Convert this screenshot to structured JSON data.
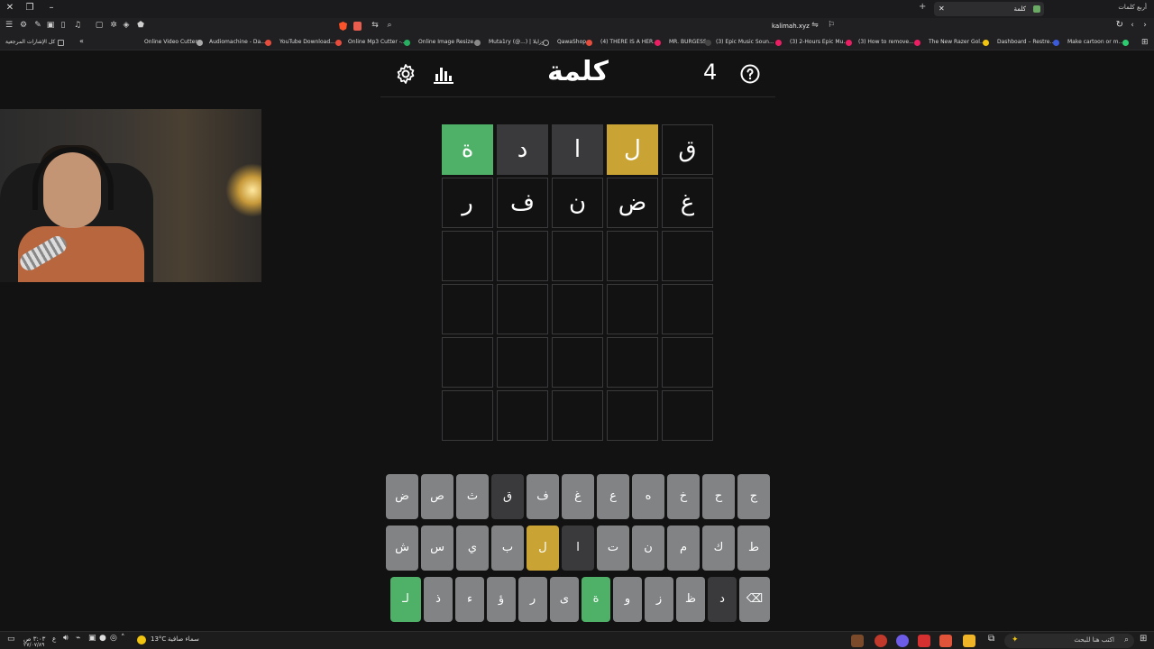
{
  "browser": {
    "tab_title": "كلمة",
    "second_tab": "أربع كلمات",
    "url": "kalimah.xyz",
    "bookmarks": [
      "Online Video Cutter",
      "Audiomachine - Da...",
      "YouTube Download...",
      "Online Mp3 Cutter -...",
      "Online Image Resize...",
      "Muta1ry (@...) | موزايلا",
      "QawaShop",
      "(4) THERE IS A HER...",
      "MR. BURGESS",
      "(3) Epic Music Soun...",
      "(3) 2-Hours Epic Mu...",
      "(3) How to remove...",
      "The New Razer Gol...",
      "Dashboard – Restre...",
      "Make cartoon or m..."
    ],
    "bookmarks_folder": "كل الإشارات المرجعية"
  },
  "game": {
    "title": "كلمة",
    "streak": "4",
    "icons": {
      "settings": "gear-icon",
      "stats": "stats-icon",
      "help": "help-icon"
    },
    "colors": {
      "green": "#4fb168",
      "yellow": "#c9a333",
      "gray": "#3a3a3c",
      "key": "#818384"
    },
    "board": [
      [
        {
          "letter": "ق",
          "state": "empty"
        },
        {
          "letter": "ل",
          "state": "yellow"
        },
        {
          "letter": "ا",
          "state": "gray"
        },
        {
          "letter": "د",
          "state": "gray"
        },
        {
          "letter": "ة",
          "state": "green"
        }
      ],
      [
        {
          "letter": "غ",
          "state": "empty"
        },
        {
          "letter": "ض",
          "state": "empty"
        },
        {
          "letter": "ن",
          "state": "empty"
        },
        {
          "letter": "ف",
          "state": "empty"
        },
        {
          "letter": "ر",
          "state": "empty"
        }
      ],
      [
        {
          "letter": "",
          "state": "empty"
        },
        {
          "letter": "",
          "state": "empty"
        },
        {
          "letter": "",
          "state": "empty"
        },
        {
          "letter": "",
          "state": "empty"
        },
        {
          "letter": "",
          "state": "empty"
        }
      ],
      [
        {
          "letter": "",
          "state": "empty"
        },
        {
          "letter": "",
          "state": "empty"
        },
        {
          "letter": "",
          "state": "empty"
        },
        {
          "letter": "",
          "state": "empty"
        },
        {
          "letter": "",
          "state": "empty"
        }
      ],
      [
        {
          "letter": "",
          "state": "empty"
        },
        {
          "letter": "",
          "state": "empty"
        },
        {
          "letter": "",
          "state": "empty"
        },
        {
          "letter": "",
          "state": "empty"
        },
        {
          "letter": "",
          "state": "empty"
        }
      ],
      [
        {
          "letter": "",
          "state": "empty"
        },
        {
          "letter": "",
          "state": "empty"
        },
        {
          "letter": "",
          "state": "empty"
        },
        {
          "letter": "",
          "state": "empty"
        },
        {
          "letter": "",
          "state": "empty"
        }
      ]
    ],
    "keyboard": [
      [
        {
          "k": "ج",
          "state": "default"
        },
        {
          "k": "ح",
          "state": "default"
        },
        {
          "k": "خ",
          "state": "default"
        },
        {
          "k": "ه",
          "state": "default"
        },
        {
          "k": "ع",
          "state": "default"
        },
        {
          "k": "غ",
          "state": "default"
        },
        {
          "k": "ف",
          "state": "default"
        },
        {
          "k": "ق",
          "state": "dark"
        },
        {
          "k": "ث",
          "state": "default"
        },
        {
          "k": "ص",
          "state": "default"
        },
        {
          "k": "ض",
          "state": "default"
        }
      ],
      [
        {
          "k": "ط",
          "state": "default"
        },
        {
          "k": "ك",
          "state": "default"
        },
        {
          "k": "م",
          "state": "default"
        },
        {
          "k": "ن",
          "state": "default"
        },
        {
          "k": "ت",
          "state": "default"
        },
        {
          "k": "ا",
          "state": "dark"
        },
        {
          "k": "ل",
          "state": "yellow"
        },
        {
          "k": "ب",
          "state": "default"
        },
        {
          "k": "ي",
          "state": "default"
        },
        {
          "k": "س",
          "state": "default"
        },
        {
          "k": "ش",
          "state": "default"
        }
      ],
      [
        {
          "k": "⌫",
          "state": "default"
        },
        {
          "k": "د",
          "state": "dark"
        },
        {
          "k": "ظ",
          "state": "default"
        },
        {
          "k": "ز",
          "state": "default"
        },
        {
          "k": "و",
          "state": "default"
        },
        {
          "k": "ة",
          "state": "green"
        },
        {
          "k": "ى",
          "state": "default"
        },
        {
          "k": "ر",
          "state": "default"
        },
        {
          "k": "ؤ",
          "state": "default"
        },
        {
          "k": "ء",
          "state": "default"
        },
        {
          "k": "ذ",
          "state": "default"
        },
        {
          "k": "ﻟـ",
          "state": "green"
        }
      ]
    ]
  },
  "taskbar": {
    "time": "٣:٠٣ ص",
    "date": "٢٧/٠٧/٨٩",
    "lang": "ع",
    "weather_temp": "13°C",
    "weather_text": "سماء صافية",
    "search_placeholder": "اكتب هنا للبحث"
  }
}
